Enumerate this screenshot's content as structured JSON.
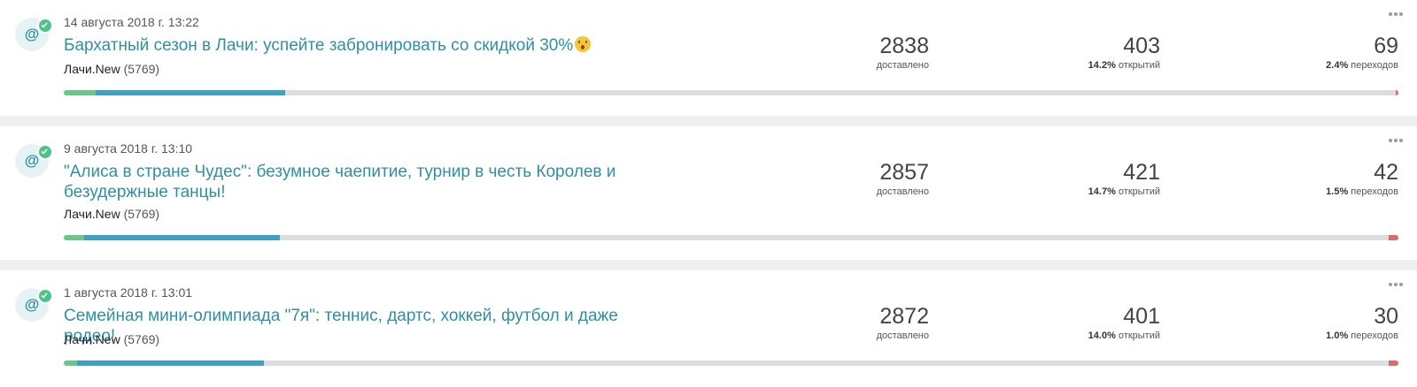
{
  "campaigns": [
    {
      "avatar_icon": "at-sign-icon",
      "avatar_glyph": "@",
      "status": "sent",
      "date": "14 августа 2018 г. 13:22",
      "title": "Бархатный сезон в Лачи: успейте забронировать со скидкой 30%",
      "title_emoji": "hushed-face-emoji",
      "sender": "Лачи.New",
      "sender_count": "(5769)",
      "delivered": "2838",
      "delivered_label": "доставлено",
      "opened": "403",
      "opened_pct": "14.2%",
      "opened_label": "открытий",
      "clicks": "69",
      "clicks_pct": "2.4%",
      "clicks_label": "переходов",
      "bar": {
        "green": 0.024,
        "blue": 0.142,
        "red": 0.002
      }
    },
    {
      "avatar_icon": "at-sign-icon",
      "avatar_glyph": "@",
      "status": "sent",
      "date": "9 августа 2018 г. 13:10",
      "title": "\"Алиса в стране Чудес\": безумное чаепитие, турнир в честь Королев и безудержные танцы!",
      "sender": "Лачи.New",
      "sender_count": "(5769)",
      "delivered": "2857",
      "delivered_label": "доставлено",
      "opened": "421",
      "opened_pct": "14.7%",
      "opened_label": "открытий",
      "clicks": "42",
      "clicks_pct": "1.5%",
      "clicks_label": "переходов",
      "bar": {
        "green": 0.015,
        "blue": 0.147,
        "red": 0.007
      }
    },
    {
      "avatar_icon": "at-sign-icon",
      "avatar_glyph": "@",
      "status": "sent",
      "date": "1 августа 2018 г. 13:01",
      "title": "Семейная мини-олимпиада \"7я\": теннис, дартс, хоккей, футбол и даже родео!",
      "sender": "Лачи.New",
      "sender_count": "(5769)",
      "delivered": "2872",
      "delivered_label": "доставлено",
      "opened": "401",
      "opened_pct": "14.0%",
      "opened_label": "открытий",
      "clicks": "30",
      "clicks_pct": "1.0%",
      "clicks_label": "переходов",
      "bar": {
        "green": 0.01,
        "blue": 0.14,
        "red": 0.007
      }
    }
  ],
  "colors": {
    "link": "#2f8fa3",
    "bar_track": "#dddddd",
    "bar_clicks": "#6cc58a",
    "bar_opens": "#3fa0c2",
    "bar_errors": "#d86b6b",
    "status_ok": "#4cc38a"
  }
}
